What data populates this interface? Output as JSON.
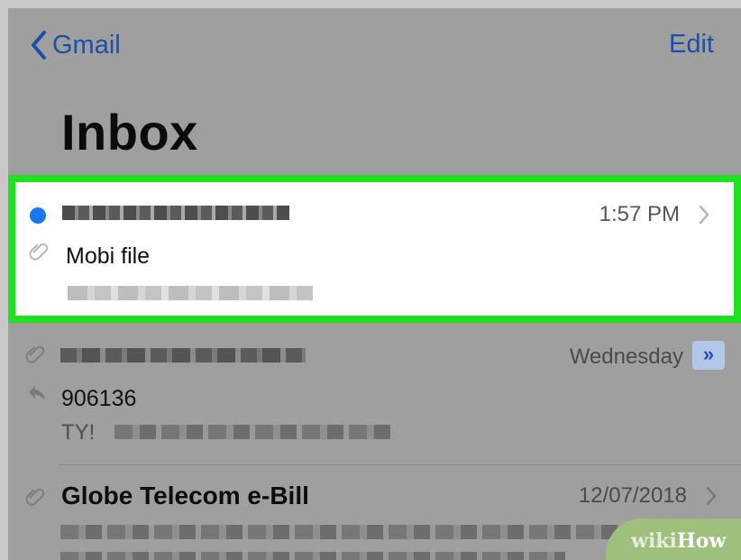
{
  "nav": {
    "back_label": "Gmail",
    "edit_label": "Edit"
  },
  "title": "Inbox",
  "emails": [
    {
      "time": "1:57 PM",
      "subject": "Mobi file",
      "unread": true,
      "attachment": true
    },
    {
      "time": "Wednesday",
      "subject": "906136",
      "preview_prefix": "TY!",
      "replied": true,
      "attachment": true,
      "thread_badge": "»"
    },
    {
      "time": "12/07/2018",
      "subject": "Globe Telecom e-Bill",
      "attachment": true
    }
  ],
  "watermark": {
    "prefix": "wiki",
    "suffix": "How"
  },
  "colors": {
    "accent": "#1d4fa8",
    "unread_dot": "#1877f2",
    "highlight": "#21e021"
  },
  "icons": [
    "chevron-left-icon",
    "chevron-right-icon",
    "paperclip-icon",
    "reply-icon",
    "double-chevron-icon"
  ]
}
